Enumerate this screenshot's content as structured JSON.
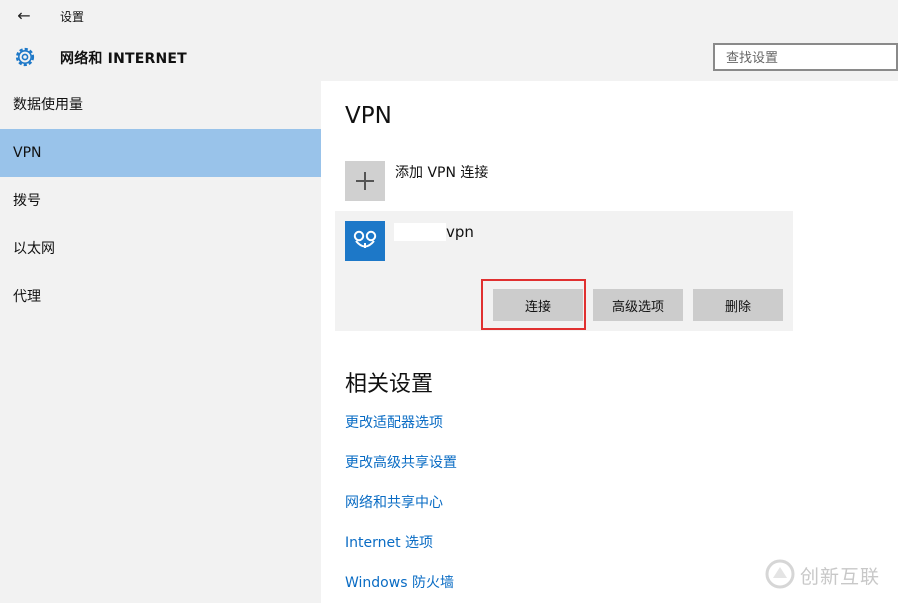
{
  "window": {
    "back_icon": "arrow-left-icon",
    "back_glyph": "←",
    "title": "设置"
  },
  "header": {
    "icon": "gear-icon",
    "section_title": "网络和 INTERNET",
    "search_placeholder": "查找设置"
  },
  "sidebar": {
    "items": [
      {
        "label": "数据使用量",
        "active": false
      },
      {
        "label": "VPN",
        "active": true
      },
      {
        "label": "拨号",
        "active": false
      },
      {
        "label": "以太网",
        "active": false
      },
      {
        "label": "代理",
        "active": false
      }
    ]
  },
  "main": {
    "title": "VPN",
    "add_vpn_label": "添加 VPN 连接",
    "vpn_connection": {
      "name": "vpn",
      "icon": "vpn-connection-icon",
      "buttons": {
        "connect": "连接",
        "advanced": "高级选项",
        "delete": "删除"
      }
    },
    "related_title": "相关设置",
    "related_links": [
      "更改适配器选项",
      "更改高级共享设置",
      "网络和共享中心",
      "Internet 选项",
      "Windows 防火墙"
    ]
  },
  "watermark": {
    "text": "创新互联",
    "icon": "watermark-logo-icon"
  },
  "colors": {
    "sidebar_bg": "#f2f2f2",
    "active_item": "#99c3ea",
    "accent_link": "#0a6cc4",
    "vpn_icon_bg": "#1d78c8",
    "highlight_border": "#e03030",
    "button_bg": "#cccccc"
  }
}
